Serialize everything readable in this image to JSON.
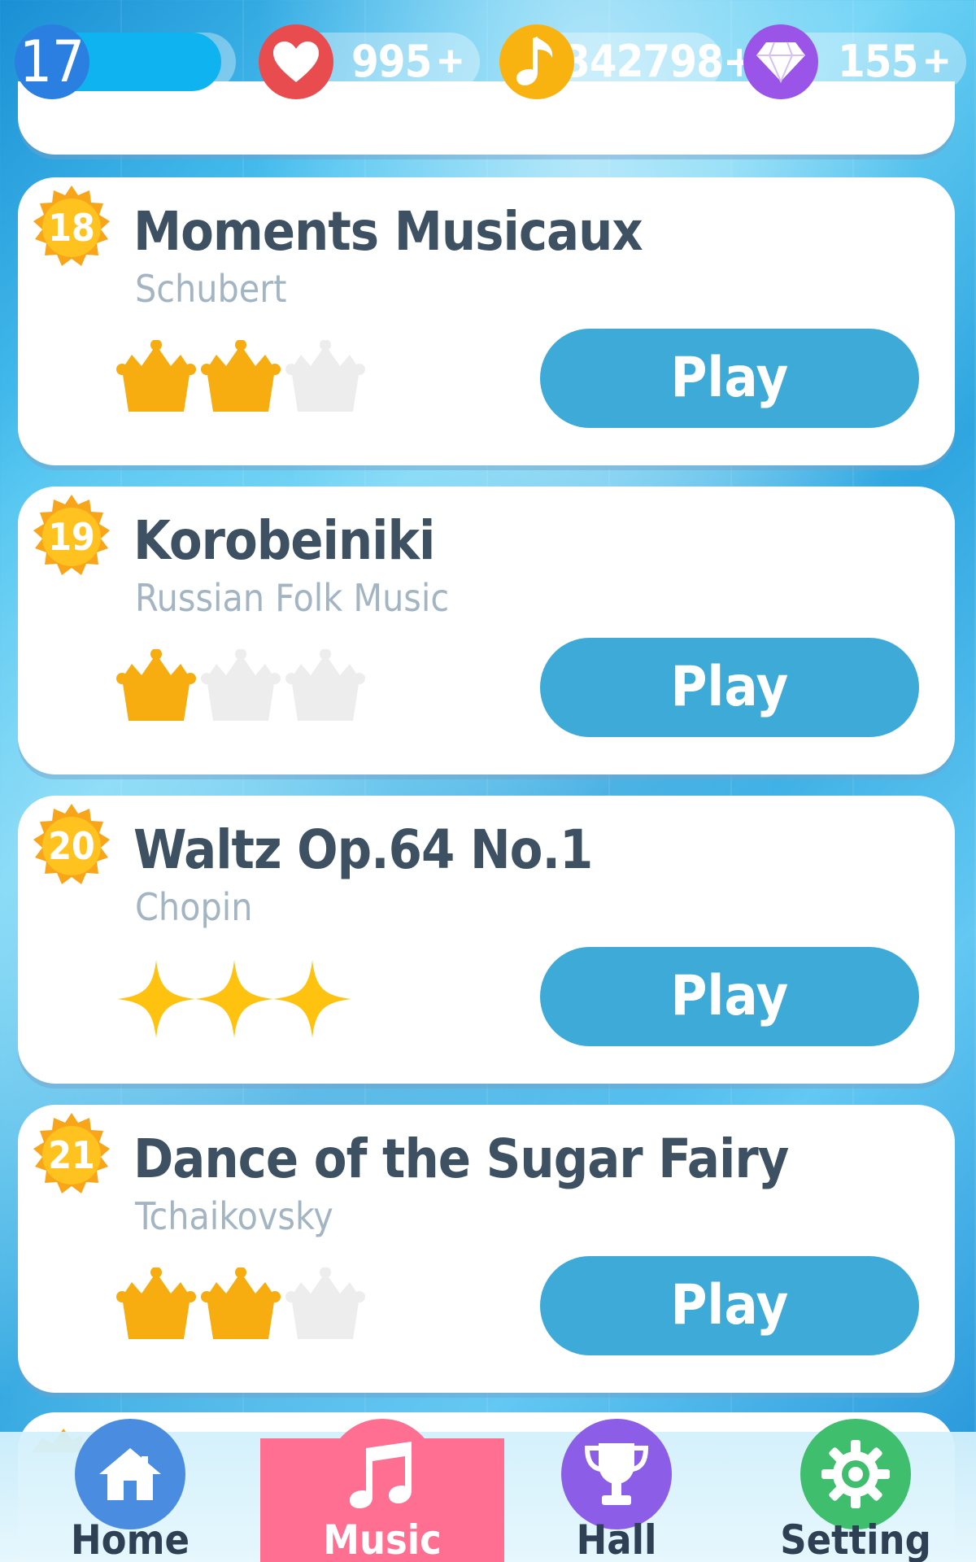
{
  "status": {
    "level": "17",
    "lives": "995",
    "notes": "342798+",
    "gems": "155",
    "plus": "+",
    "colors": {
      "heart": "#e84c4f",
      "note": "#f9b311",
      "gem": "#9a55e8",
      "level": "#2a7fe0"
    }
  },
  "songs": [
    {
      "rank": "18",
      "title": "Moments Musicaux",
      "composer": "Schubert",
      "crowns": 2,
      "max_crowns": 3,
      "rating_type": "crown",
      "play_label": "Play"
    },
    {
      "rank": "19",
      "title": "Korobeiniki",
      "composer": "Russian Folk Music",
      "crowns": 1,
      "max_crowns": 3,
      "rating_type": "crown",
      "play_label": "Play"
    },
    {
      "rank": "20",
      "title": "Waltz Op.64 No.1",
      "composer": "Chopin",
      "crowns": 3,
      "max_crowns": 3,
      "rating_type": "sparkle",
      "play_label": "Play"
    },
    {
      "rank": "21",
      "title": "Dance of the Sugar Fairy",
      "composer": "Tchaikovsky",
      "crowns": 2,
      "max_crowns": 3,
      "rating_type": "crown",
      "play_label": "Play"
    }
  ],
  "nav": {
    "items": [
      {
        "label": "Home",
        "icon": "house-icon",
        "color": "#4a8de0"
      },
      {
        "label": "Music",
        "icon": "music-note-icon",
        "color": "#ff6f92",
        "active": true
      },
      {
        "label": "Hall",
        "icon": "trophy-icon",
        "color": "#8c5ee8"
      },
      {
        "label": "Setting",
        "icon": "gear-icon",
        "color": "#3fbf6e"
      }
    ]
  }
}
